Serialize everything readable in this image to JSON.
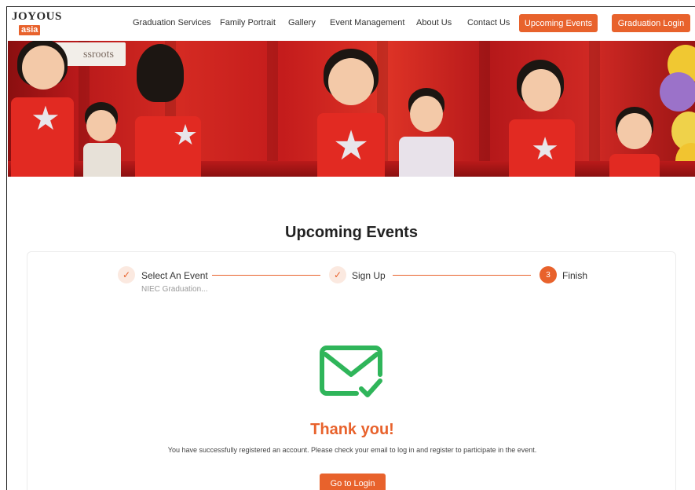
{
  "brand": {
    "logo_top": "JOYOUS",
    "logo_bottom": "asia"
  },
  "nav": {
    "items": [
      {
        "label": "Graduation Services"
      },
      {
        "label": "Family Portrait"
      },
      {
        "label": "Gallery"
      },
      {
        "label": "Event Management"
      },
      {
        "label": "About Us"
      },
      {
        "label": "Contact Us"
      }
    ],
    "upcoming_events_button": "Upcoming Events",
    "graduation_login_button": "Graduation Login"
  },
  "banner": {
    "sign_text": "ssroots",
    "icon": "children-performance-photo"
  },
  "page": {
    "title": "Upcoming Events"
  },
  "steps": [
    {
      "label": "Select An Event",
      "sub": "NIEC Graduation...",
      "status": "done",
      "icon": "check-icon"
    },
    {
      "label": "Sign Up",
      "sub": "",
      "status": "done",
      "icon": "check-icon"
    },
    {
      "label": "Finish",
      "number": "3",
      "status": "active"
    }
  ],
  "result": {
    "icon": "mail-check-icon",
    "heading": "Thank you!",
    "message": "You have successfully registered an account. Please check your email to log in and register to participate in the event.",
    "button_label": "Go to Login"
  },
  "colors": {
    "accent": "#e8622c",
    "success": "#2fb55a",
    "step_done_bg": "#fbe9e0"
  }
}
